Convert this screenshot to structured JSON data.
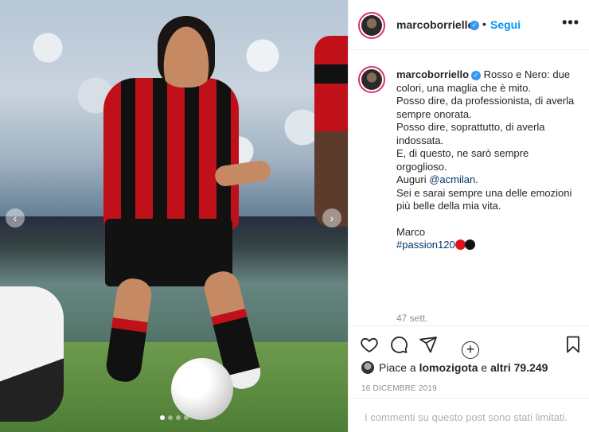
{
  "post": {
    "username": "marcoborriello",
    "follow_label": "Segui",
    "separator": "•",
    "more_label": "•••",
    "verified_glyph": "✓",
    "caption": {
      "lines": [
        "Rosso e Nero: due colori, una maglia che è mito.",
        "Posso dire, da professionista, di averla sempre onorata.",
        "Posso dire, soprattutto, di averla indossata.",
        "E, di questo, ne sarò sempre orgoglioso."
      ],
      "auguri_prefix": "Auguri ",
      "mention": "@acmilan",
      "mention_suffix": ".",
      "closing": "Sei e sarai sempre una delle emozioni più belle della mia vita.",
      "signature": "Marco",
      "hashtag": "#passion120"
    },
    "time_ago": "47 sett.",
    "likes": {
      "prefix": "Piace a ",
      "user": "lomozigota",
      "middle": " e ",
      "others": "altri 79.249"
    },
    "date": "16 DICEMBRE 2019",
    "comments_limited": "I commenti su questo post sono stati limitati.",
    "load_more_glyph": "+"
  },
  "carousel": {
    "prev_glyph": "‹",
    "next_glyph": "›",
    "dots": 4,
    "active_dot": 1
  },
  "icons": {
    "like": "heart-icon",
    "comment": "comment-icon",
    "share": "share-icon",
    "save": "bookmark-icon"
  },
  "colors": {
    "follow": "#0095f6",
    "verified": "#3897f0",
    "link": "#00376b",
    "story_ring": "#e1306c",
    "muted": "#8e8e8e"
  }
}
